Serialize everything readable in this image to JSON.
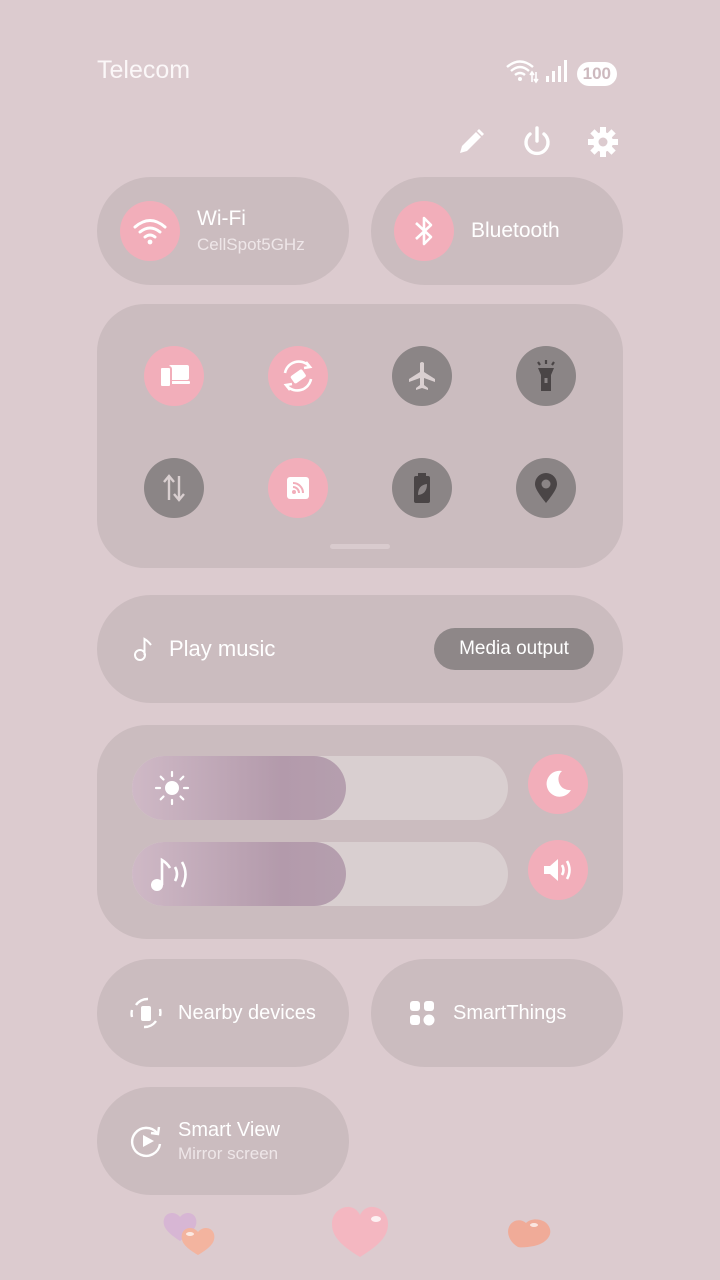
{
  "status": {
    "carrier": "Telecom",
    "battery": "100"
  },
  "top_actions": [
    "edit-icon",
    "power-icon",
    "settings-icon"
  ],
  "wifi": {
    "title": "Wi-Fi",
    "network": "CellSpot5GHz"
  },
  "bluetooth": {
    "title": "Bluetooth"
  },
  "quick_settings": [
    {
      "icon": "device-link-icon",
      "state": "on"
    },
    {
      "icon": "auto-rotate-icon",
      "state": "on"
    },
    {
      "icon": "airplane-icon",
      "state": "off"
    },
    {
      "icon": "flashlight-icon",
      "state": "off"
    },
    {
      "icon": "mobile-data-icon",
      "state": "off"
    },
    {
      "icon": "cast-icon",
      "state": "on"
    },
    {
      "icon": "power-saving-icon",
      "state": "off"
    },
    {
      "icon": "location-icon",
      "state": "off"
    }
  ],
  "media": {
    "label": "Play music",
    "output_button": "Media output"
  },
  "sliders": {
    "brightness": {
      "icon": "brightness-icon",
      "level": 0.57
    },
    "volume": {
      "icon": "sound-icon",
      "level": 0.57
    }
  },
  "tiles": {
    "nearby": "Nearby devices",
    "smartthings": "SmartThings",
    "smart_view": {
      "title": "Smart View",
      "subtitle": "Mirror screen"
    }
  },
  "colors": {
    "background": "#dccbcf",
    "panel": "#cbbcbf",
    "active": "#f2aeba",
    "inactive": "#8b8586"
  }
}
